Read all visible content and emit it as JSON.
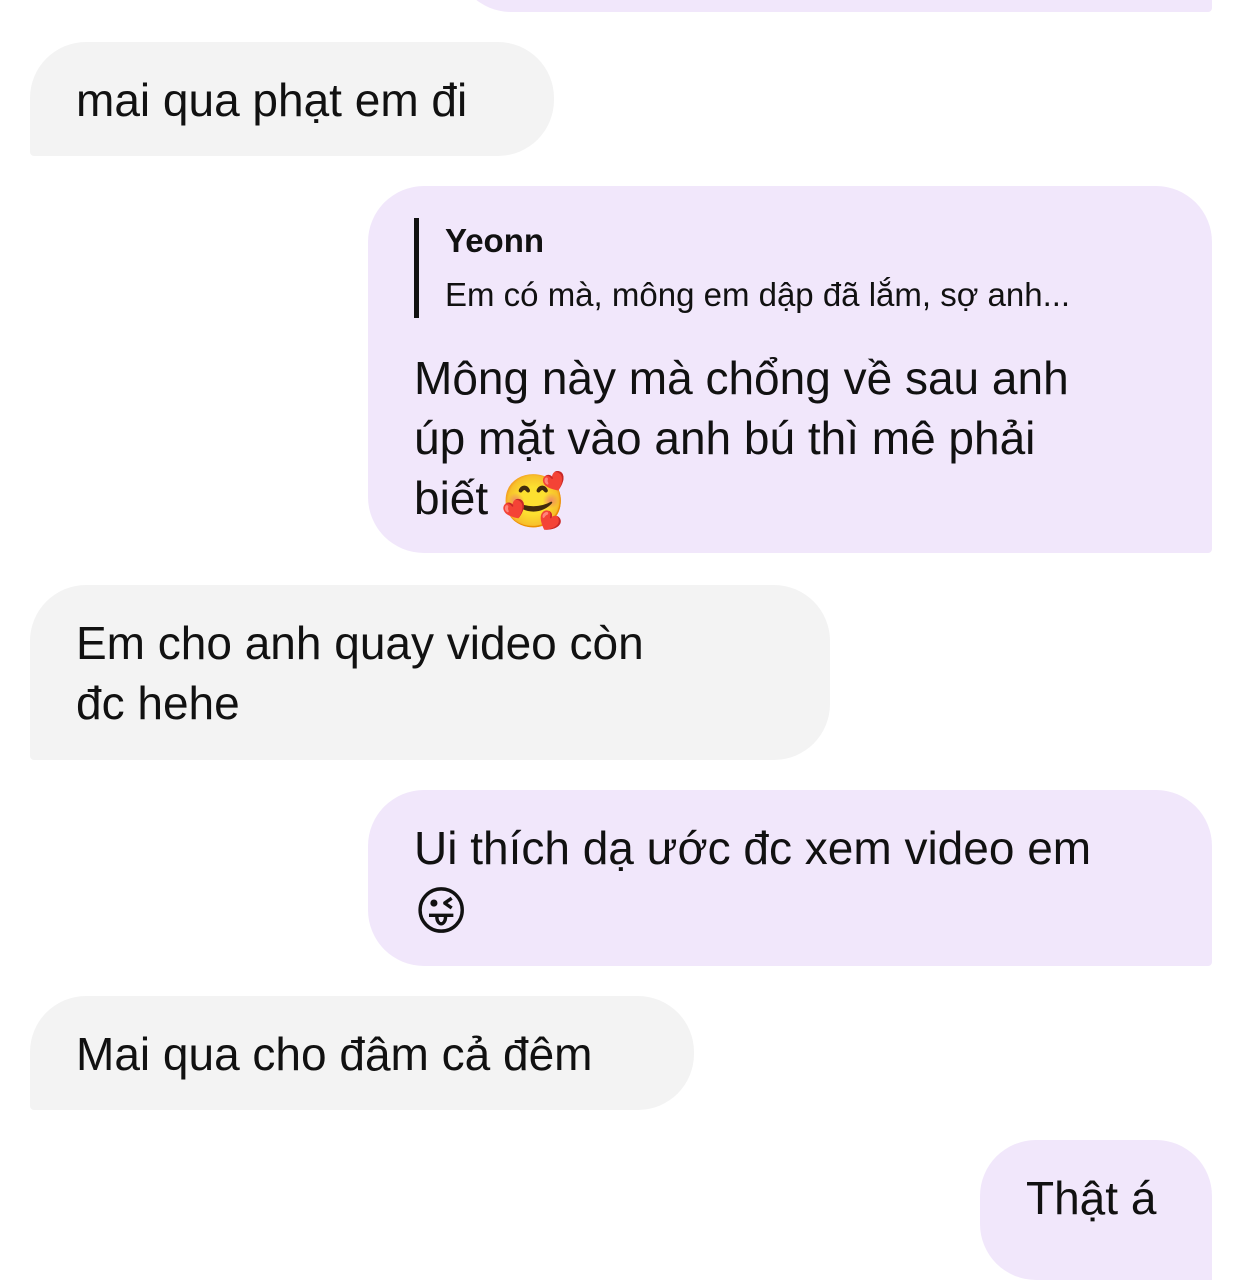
{
  "messages": [
    {
      "side": "received",
      "text": "mai qua phạt em đi"
    },
    {
      "side": "sent",
      "reply_to": {
        "author": "Yeonn",
        "text": "Em có mà, mông em dập đã lắm, sợ anh..."
      },
      "text": "Mông này mà chổng về sau anh\núp mặt vào anh bú thì mê phải\nbiết",
      "emoji": "🥰"
    },
    {
      "side": "received",
      "text": "Em cho anh quay video còn\nđc hehe"
    },
    {
      "side": "sent",
      "text": "Ui thích dạ ước đc xem video em",
      "emoji": "😜"
    },
    {
      "side": "received",
      "text": "Mai qua cho đâm cả đêm"
    },
    {
      "side": "sent",
      "text": "Thật á"
    }
  ],
  "colors": {
    "received_bubble": "#f3f3f3",
    "sent_bubble": "#f1e7fb",
    "text": "#111111"
  }
}
